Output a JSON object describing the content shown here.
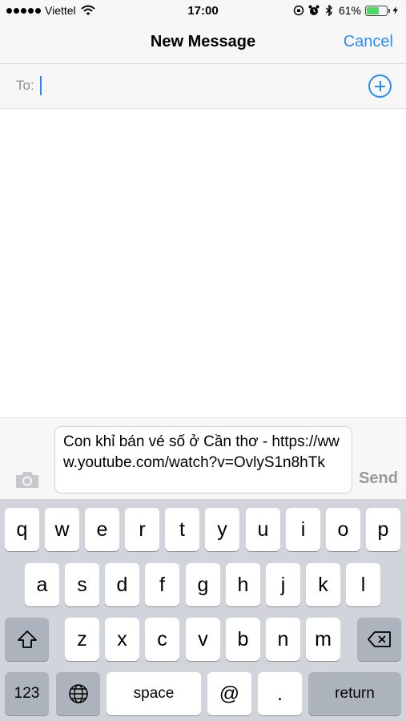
{
  "status_bar": {
    "carrier": "Viettel",
    "time": "17:00",
    "battery_percent": "61%",
    "battery_level": 0.61,
    "icons": [
      "signal-dots-icon",
      "wifi-icon",
      "orientation-lock-icon",
      "alarm-icon",
      "bluetooth-icon",
      "battery-icon",
      "charging-bolt-icon"
    ]
  },
  "nav": {
    "title": "New Message",
    "cancel_label": "Cancel"
  },
  "to_field": {
    "label": "To:",
    "value": "",
    "add_icon": "add-contact-plus-icon"
  },
  "composer": {
    "message_text": "Con khỉ bán vé số ở Cần thơ - https://www.youtube.com/watch?v=OvlyS1n8hTk",
    "send_label": "Send",
    "camera_icon": "camera-icon"
  },
  "keyboard": {
    "row1": [
      "q",
      "w",
      "e",
      "r",
      "t",
      "y",
      "u",
      "i",
      "o",
      "p"
    ],
    "row2": [
      "a",
      "s",
      "d",
      "f",
      "g",
      "h",
      "j",
      "k",
      "l"
    ],
    "row3": [
      "z",
      "x",
      "c",
      "v",
      "b",
      "n",
      "m"
    ],
    "numbers_label": "123",
    "space_label": "space",
    "at_label": "@",
    "period_label": ".",
    "return_label": "return",
    "icons": [
      "shift-icon",
      "backspace-icon",
      "globe-icon"
    ]
  },
  "colors": {
    "accent": "#2a8af6",
    "bar_background": "#f7f7f7",
    "keyboard_background": "#d1d5db",
    "dark_key": "#adb3bc",
    "battery_green": "#4cd964",
    "send_disabled": "#9a9a9e"
  }
}
